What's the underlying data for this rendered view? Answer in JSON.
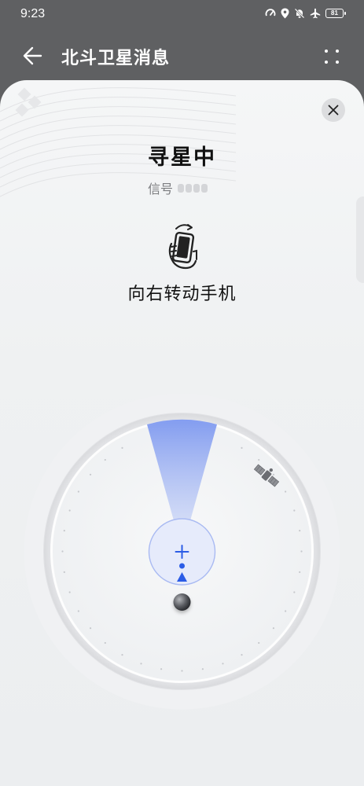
{
  "status_bar": {
    "time": "9:23",
    "battery": "81",
    "icons": [
      "speedometer-icon",
      "location-icon",
      "bell-off-icon",
      "airplane-icon",
      "battery-icon"
    ]
  },
  "header": {
    "title": "北斗卫星消息",
    "back_icon": "arrow-left-icon",
    "more_icon": "more-dots-icon"
  },
  "sheet": {
    "title": "寻星中",
    "signal_label": "信号",
    "signal_level": 0,
    "signal_max": 4,
    "instruction": "向右转动手机",
    "close_icon": "close-icon",
    "phone_icon": "rotate-phone-icon",
    "satellite_icon": "satellite-icon"
  },
  "colors": {
    "header_bg": "#5f6062",
    "sheet_bg": "#f2f3f5",
    "beam": "#6f8ff0",
    "pointer": "#2b5ce6"
  }
}
